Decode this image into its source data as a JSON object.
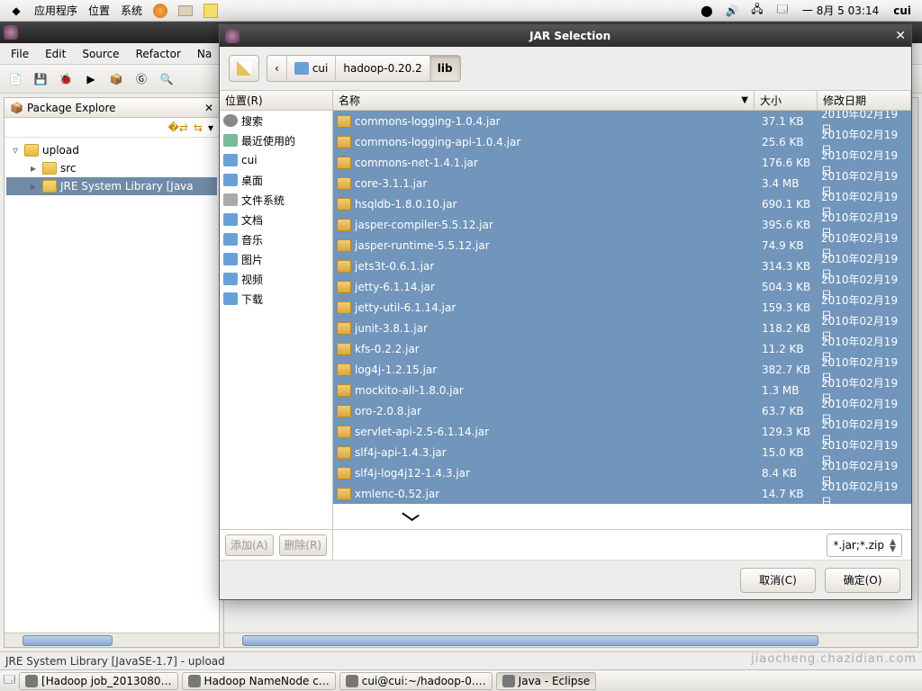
{
  "gnome": {
    "menus": [
      "应用程序",
      "位置",
      "系统"
    ],
    "clock": "一 8月  5 03:14",
    "user": "cui"
  },
  "eclipse": {
    "menubar": [
      "File",
      "Edit",
      "Source",
      "Refactor",
      "Na"
    ],
    "view_title": "Package Explore",
    "tree": {
      "project": "upload",
      "src": "src",
      "jre": "JRE System Library [Java"
    },
    "status": "JRE System Library [JavaSE-1.7] - upload"
  },
  "dialog": {
    "title": "JAR Selection",
    "back_label": "‹",
    "crumbs": {
      "home": "cui",
      "mid": "hadoop-0.20.2",
      "active": "lib"
    },
    "places_header": "位置(R)",
    "places": [
      {
        "icon": "search",
        "label": "搜索"
      },
      {
        "icon": "recent",
        "label": "最近使用的"
      },
      {
        "icon": "home",
        "label": "cui"
      },
      {
        "icon": "folder",
        "label": "桌面"
      },
      {
        "icon": "hd",
        "label": "文件系统"
      },
      {
        "icon": "folder",
        "label": "文档"
      },
      {
        "icon": "folder",
        "label": "音乐"
      },
      {
        "icon": "folder",
        "label": "图片"
      },
      {
        "icon": "folder",
        "label": "视频"
      },
      {
        "icon": "folder",
        "label": "下载"
      }
    ],
    "add_btn": "添加(A)",
    "remove_btn": "删除(R)",
    "columns": {
      "name": "名称",
      "size": "大小",
      "date": "修改日期"
    },
    "files": [
      {
        "name": "commons-logging-1.0.4.jar",
        "size": "37.1 KB",
        "date": "2010年02月19日"
      },
      {
        "name": "commons-logging-api-1.0.4.jar",
        "size": "25.6 KB",
        "date": "2010年02月19日"
      },
      {
        "name": "commons-net-1.4.1.jar",
        "size": "176.6 KB",
        "date": "2010年02月19日"
      },
      {
        "name": "core-3.1.1.jar",
        "size": "3.4 MB",
        "date": "2010年02月19日"
      },
      {
        "name": "hsqldb-1.8.0.10.jar",
        "size": "690.1 KB",
        "date": "2010年02月19日"
      },
      {
        "name": "jasper-compiler-5.5.12.jar",
        "size": "395.6 KB",
        "date": "2010年02月19日"
      },
      {
        "name": "jasper-runtime-5.5.12.jar",
        "size": "74.9 KB",
        "date": "2010年02月19日"
      },
      {
        "name": "jets3t-0.6.1.jar",
        "size": "314.3 KB",
        "date": "2010年02月19日"
      },
      {
        "name": "jetty-6.1.14.jar",
        "size": "504.3 KB",
        "date": "2010年02月19日"
      },
      {
        "name": "jetty-util-6.1.14.jar",
        "size": "159.3 KB",
        "date": "2010年02月19日"
      },
      {
        "name": "junit-3.8.1.jar",
        "size": "118.2 KB",
        "date": "2010年02月19日"
      },
      {
        "name": "kfs-0.2.2.jar",
        "size": "11.2 KB",
        "date": "2010年02月19日"
      },
      {
        "name": "log4j-1.2.15.jar",
        "size": "382.7 KB",
        "date": "2010年02月19日"
      },
      {
        "name": "mockito-all-1.8.0.jar",
        "size": "1.3 MB",
        "date": "2010年02月19日"
      },
      {
        "name": "oro-2.0.8.jar",
        "size": "63.7 KB",
        "date": "2010年02月19日"
      },
      {
        "name": "servlet-api-2.5-6.1.14.jar",
        "size": "129.3 KB",
        "date": "2010年02月19日"
      },
      {
        "name": "slf4j-api-1.4.3.jar",
        "size": "15.0 KB",
        "date": "2010年02月19日"
      },
      {
        "name": "slf4j-log4j12-1.4.3.jar",
        "size": "8.4 KB",
        "date": "2010年02月19日"
      },
      {
        "name": "xmlenc-0.52.jar",
        "size": "14.7 KB",
        "date": "2010年02月19日"
      }
    ],
    "filter": "*.jar;*.zip",
    "cancel": "取消(C)",
    "ok": "确定(O)"
  },
  "taskbar": [
    {
      "label": "[Hadoop job_2013080…"
    },
    {
      "label": "Hadoop NameNode c…"
    },
    {
      "label": "cui@cui:~/hadoop-0.…"
    },
    {
      "label": "Java - Eclipse"
    }
  ],
  "watermark": "jiaocheng.chazidian.com"
}
